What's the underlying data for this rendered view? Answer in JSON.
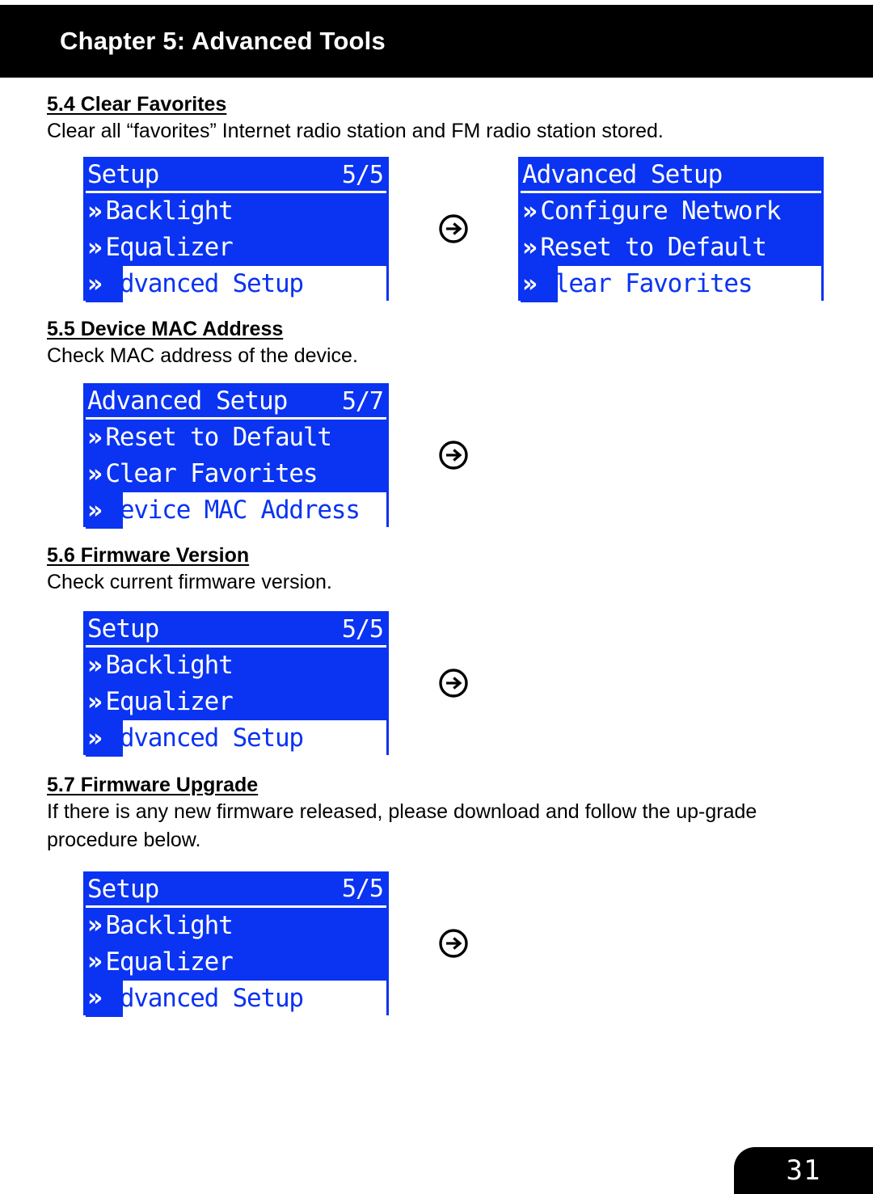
{
  "header": {
    "chapter_title": "Chapter 5: Advanced Tools"
  },
  "page": {
    "number": "31"
  },
  "icons": {
    "next_arrow": "arrow-right-circle-icon"
  },
  "sections": [
    {
      "heading": "5.4 Clear Favorites",
      "body": "Clear all “favorites” Internet radio station and FM radio station stored.",
      "screens": [
        {
          "title": "Setup",
          "page_indicator": "5/5",
          "items": [
            {
              "label": "Backlight",
              "selected": false
            },
            {
              "label": "Equalizer",
              "selected": false
            },
            {
              "label": "Advanced Setup",
              "selected": true
            }
          ]
        },
        {
          "title": "Advanced Setup",
          "page_indicator": "",
          "items": [
            {
              "label": "Configure Network",
              "selected": false
            },
            {
              "label": "Reset to Default",
              "selected": false
            },
            {
              "label": "Clear Favorites",
              "selected": true
            }
          ]
        }
      ]
    },
    {
      "heading": "5.5 Device MAC Address",
      "body": "Check MAC address of the device.",
      "screens": [
        {
          "title": "Advanced Setup",
          "page_indicator": "5/7",
          "items": [
            {
              "label": "Reset to Default",
              "selected": false
            },
            {
              "label": "Clear Favorites",
              "selected": false
            },
            {
              "label": "Device MAC Address",
              "selected": true
            }
          ]
        }
      ]
    },
    {
      "heading": "5.6 Firmware Version",
      "body": "Check current firmware version.",
      "screens": [
        {
          "title": "Setup",
          "page_indicator": "5/5",
          "items": [
            {
              "label": "Backlight",
              "selected": false
            },
            {
              "label": "Equalizer",
              "selected": false
            },
            {
              "label": "Advanced Setup",
              "selected": true
            }
          ]
        }
      ]
    },
    {
      "heading": "5.7 Firmware Upgrade",
      "body": "If there is any new firmware released, please download and follow the up-grade procedure below.",
      "screens": [
        {
          "title": "Setup",
          "page_indicator": "5/5",
          "items": [
            {
              "label": "Backlight",
              "selected": false
            },
            {
              "label": "Equalizer",
              "selected": false
            },
            {
              "label": "Advanced Setup",
              "selected": true
            }
          ]
        }
      ]
    }
  ],
  "colors": {
    "lcd_blue": "#0A33F2",
    "lcd_text": "#ffffff",
    "header_bg": "#000000"
  }
}
